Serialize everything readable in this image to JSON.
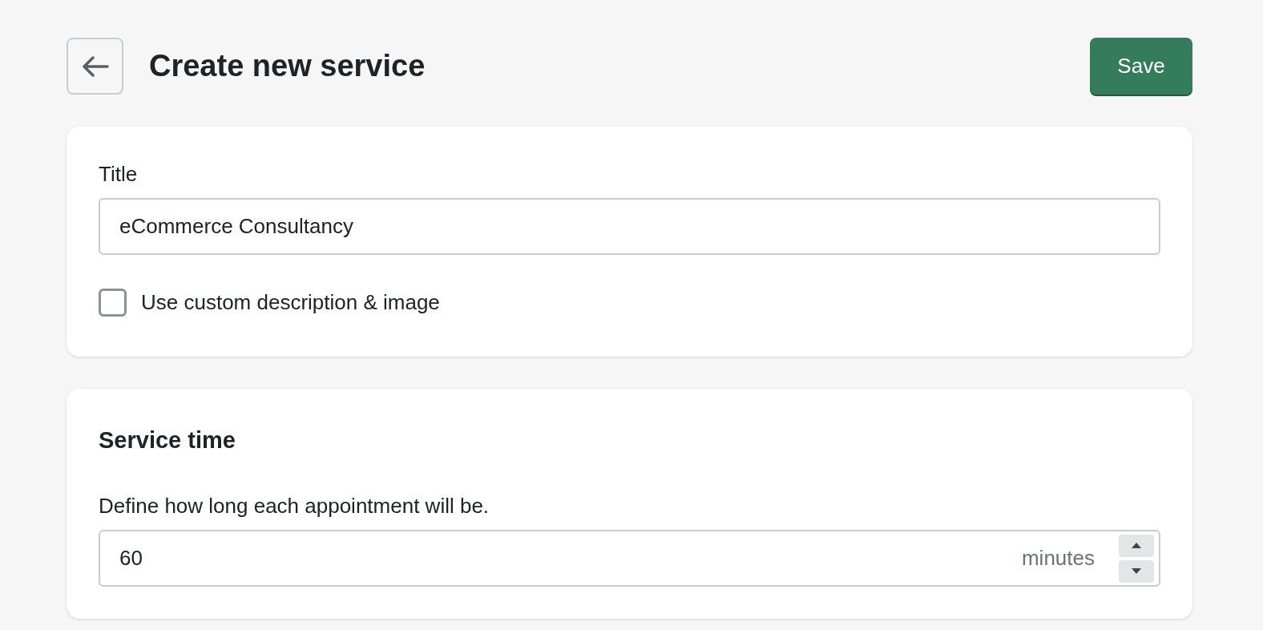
{
  "header": {
    "title": "Create new service",
    "save_label": "Save"
  },
  "title_card": {
    "label": "Title",
    "value": "eCommerce Consultancy",
    "custom_checkbox": {
      "label": "Use custom description & image",
      "checked": false
    }
  },
  "service_time": {
    "heading": "Service time",
    "description": "Define how long each appointment will be.",
    "value": "60",
    "suffix": "minutes"
  }
}
